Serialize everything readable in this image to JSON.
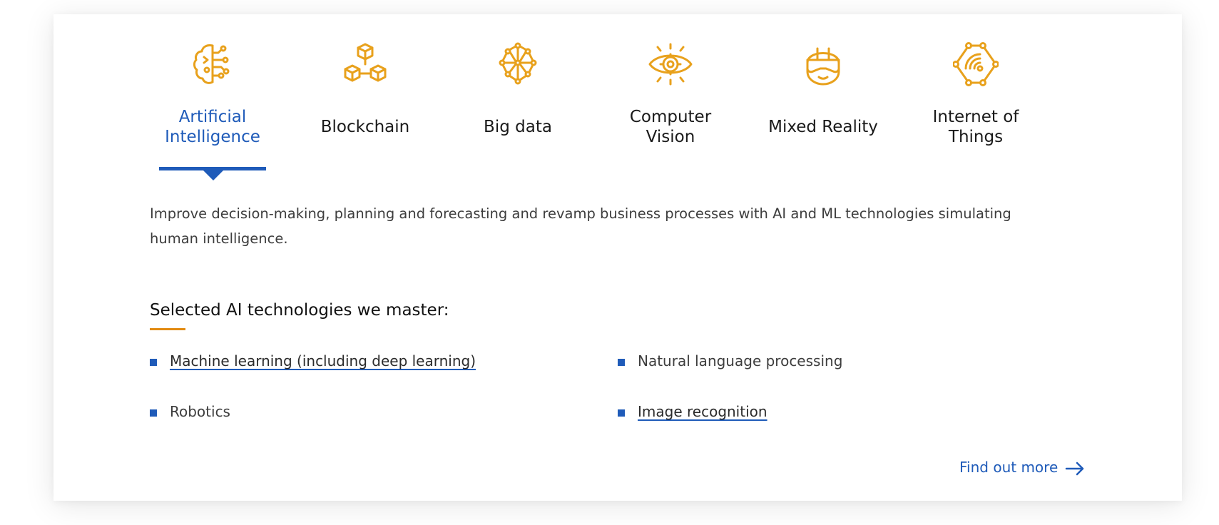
{
  "tabs": [
    {
      "label": "Artificial Intelligence",
      "icon": "brain-circuit-icon",
      "active": true
    },
    {
      "label": "Blockchain",
      "icon": "cubes-network-icon",
      "active": false
    },
    {
      "label": "Big data",
      "icon": "data-network-icon",
      "active": false
    },
    {
      "label": "Computer Vision",
      "icon": "eye-target-icon",
      "active": false
    },
    {
      "label": "Mixed Reality",
      "icon": "vr-headset-icon",
      "active": false
    },
    {
      "label": "Internet of Things",
      "icon": "iot-hexagon-icon",
      "active": false
    }
  ],
  "colors": {
    "accent": "#1f5bb9",
    "icon": "#e8a11c",
    "section_bar": "#e28a11"
  },
  "description": "Improve decision-making, planning and forecasting and revamp business processes with AI and ML technologies simulating human intelligence.",
  "section": {
    "title": "Selected AI technologies we master:"
  },
  "technologies": [
    {
      "label": "Machine learning (including deep learning)",
      "link": true
    },
    {
      "label": "Natural language processing",
      "link": false
    },
    {
      "label": "Robotics",
      "link": false
    },
    {
      "label": "Image recognition",
      "link": true
    }
  ],
  "cta": {
    "label": "Find out more"
  }
}
